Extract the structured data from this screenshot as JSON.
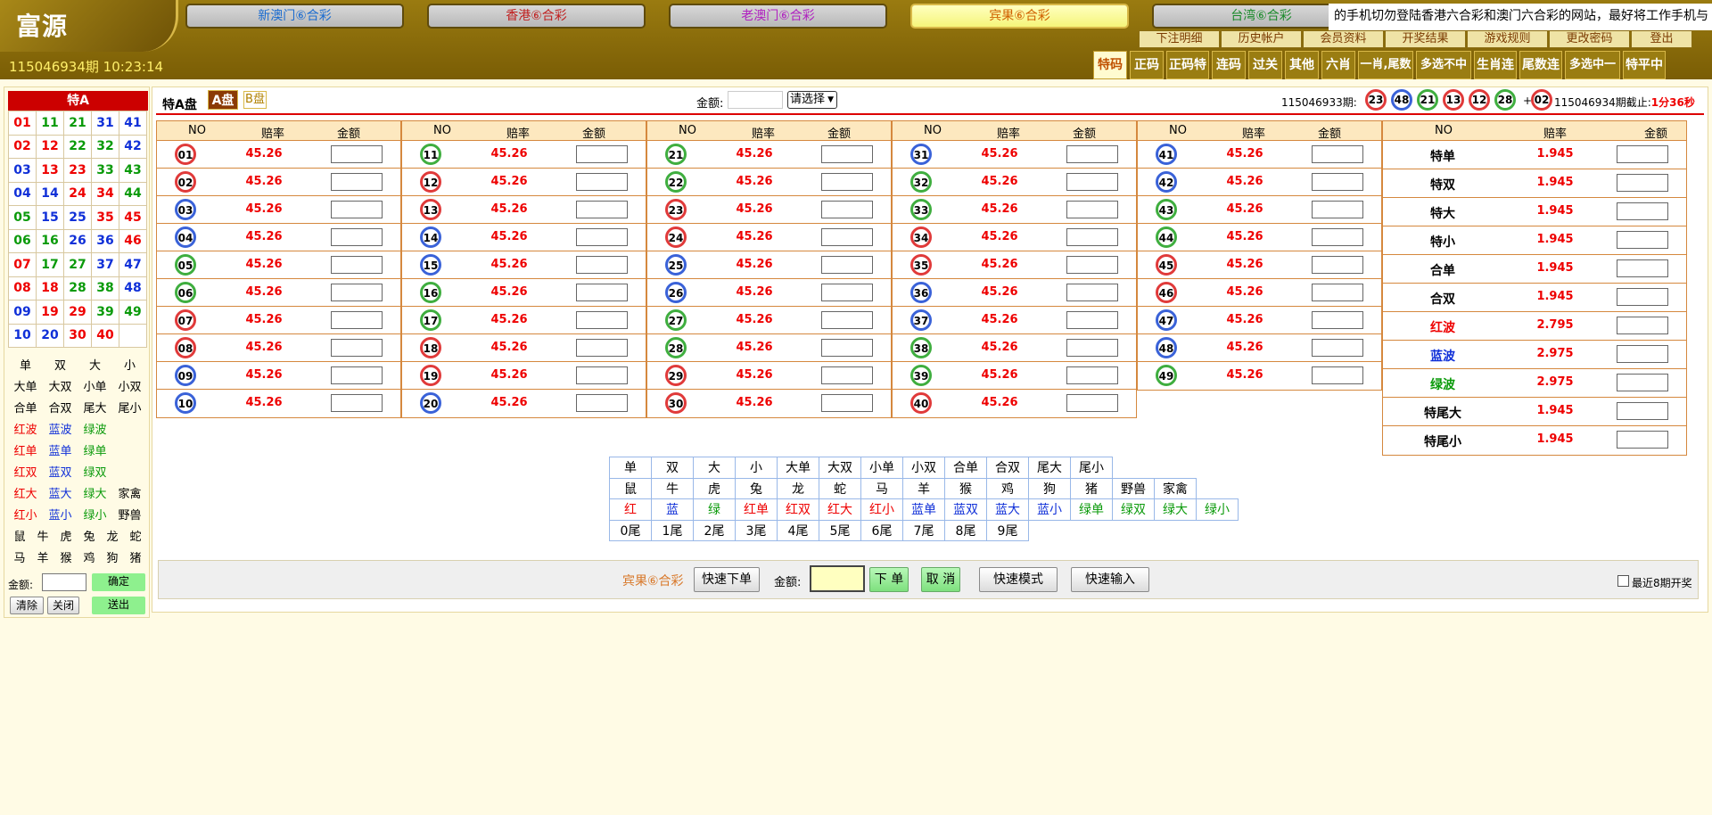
{
  "brand": {
    "logo": "富源",
    "issue_time": "115046934期 10:23:14"
  },
  "lotto_tabs": [
    {
      "label": "新澳门⑥合彩",
      "color": "#1a6bd0"
    },
    {
      "label": "香港⑥合彩",
      "color": "#c02020"
    },
    {
      "label": "老澳门⑥合彩",
      "color": "#b020c0"
    },
    {
      "label": "宾果⑥合彩",
      "color": "#d06000"
    },
    {
      "label": "台湾⑥合彩",
      "color": "#1a8a2a"
    }
  ],
  "ticker": "的手机切勿登陆香港六合彩和澳门六合彩的网站，最好将工作手机与",
  "top_menu": [
    "下注明细",
    "历史帐户",
    "会员资料",
    "开奖结果",
    "游戏规则",
    "更改密码",
    "登出"
  ],
  "nav_tabs": [
    "特码",
    "正码",
    "正码特",
    "连码",
    "过关",
    "其他",
    "六肖",
    "一肖,尾数",
    "多选不中",
    "生肖连",
    "尾数连",
    "多选中一",
    "特平中"
  ],
  "sidebar": {
    "title": "特A",
    "grid": [
      [
        "01",
        "11",
        "21",
        "31",
        "41"
      ],
      [
        "02",
        "12",
        "22",
        "32",
        "42"
      ],
      [
        "03",
        "13",
        "23",
        "33",
        "43"
      ],
      [
        "04",
        "14",
        "24",
        "34",
        "44"
      ],
      [
        "05",
        "15",
        "25",
        "35",
        "45"
      ],
      [
        "06",
        "16",
        "26",
        "36",
        "46"
      ],
      [
        "07",
        "17",
        "27",
        "37",
        "47"
      ],
      [
        "08",
        "18",
        "28",
        "38",
        "48"
      ],
      [
        "09",
        "19",
        "29",
        "39",
        "49"
      ],
      [
        "10",
        "20",
        "30",
        "40",
        ""
      ]
    ],
    "grid_colors": [
      [
        "r",
        "g",
        "g",
        "b",
        "b"
      ],
      [
        "r",
        "r",
        "g",
        "g",
        "b"
      ],
      [
        "b",
        "r",
        "r",
        "g",
        "g"
      ],
      [
        "b",
        "b",
        "r",
        "r",
        "g"
      ],
      [
        "g",
        "b",
        "b",
        "r",
        "r"
      ],
      [
        "g",
        "g",
        "b",
        "b",
        "r"
      ],
      [
        "r",
        "g",
        "g",
        "b",
        "b"
      ],
      [
        "r",
        "r",
        "g",
        "g",
        "b"
      ],
      [
        "b",
        "r",
        "r",
        "g",
        "g"
      ],
      [
        "b",
        "b",
        "r",
        "r",
        "k"
      ]
    ],
    "options": [
      [
        {
          "t": "单",
          "c": "k"
        },
        {
          "t": "双",
          "c": "k"
        },
        {
          "t": "大",
          "c": "k"
        },
        {
          "t": "小",
          "c": "k"
        }
      ],
      [
        {
          "t": "大单",
          "c": "k"
        },
        {
          "t": "大双",
          "c": "k"
        },
        {
          "t": "小单",
          "c": "k"
        },
        {
          "t": "小双",
          "c": "k"
        }
      ],
      [
        {
          "t": "合单",
          "c": "k"
        },
        {
          "t": "合双",
          "c": "k"
        },
        {
          "t": "尾大",
          "c": "k"
        },
        {
          "t": "尾小",
          "c": "k"
        }
      ],
      [
        {
          "t": "红波",
          "c": "r"
        },
        {
          "t": "蓝波",
          "c": "b"
        },
        {
          "t": "绿波",
          "c": "g"
        }
      ],
      [
        {
          "t": "红单",
          "c": "r"
        },
        {
          "t": "蓝单",
          "c": "b"
        },
        {
          "t": "绿单",
          "c": "g"
        }
      ],
      [
        {
          "t": "红双",
          "c": "r"
        },
        {
          "t": "蓝双",
          "c": "b"
        },
        {
          "t": "绿双",
          "c": "g"
        }
      ],
      [
        {
          "t": "红大",
          "c": "r"
        },
        {
          "t": "蓝大",
          "c": "b"
        },
        {
          "t": "绿大",
          "c": "g"
        },
        {
          "t": "家禽",
          "c": "k"
        }
      ],
      [
        {
          "t": "红小",
          "c": "r"
        },
        {
          "t": "蓝小",
          "c": "b"
        },
        {
          "t": "绿小",
          "c": "g"
        },
        {
          "t": "野兽",
          "c": "k"
        }
      ],
      [
        {
          "t": "鼠",
          "c": "k"
        },
        {
          "t": "牛",
          "c": "k"
        },
        {
          "t": "虎",
          "c": "k"
        },
        {
          "t": "兔",
          "c": "k"
        },
        {
          "t": "龙",
          "c": "k"
        },
        {
          "t": "蛇",
          "c": "k"
        }
      ],
      [
        {
          "t": "马",
          "c": "k"
        },
        {
          "t": "羊",
          "c": "k"
        },
        {
          "t": "猴",
          "c": "k"
        },
        {
          "t": "鸡",
          "c": "k"
        },
        {
          "t": "狗",
          "c": "k"
        },
        {
          "t": "猪",
          "c": "k"
        }
      ]
    ],
    "amount_label": "金额:",
    "confirm": "确定",
    "clear": "清除",
    "close": "关闭",
    "submit": "送出"
  },
  "main": {
    "plate_title": "特A盘",
    "plate_a": "A盘",
    "plate_b": "B盘",
    "amount_label": "金额:",
    "select_placeholder": "请选择",
    "last_issue": "115046933期:",
    "last_balls": [
      "23",
      "48",
      "21",
      "13",
      "12",
      "28"
    ],
    "last_ball_colors": [
      "red",
      "blue",
      "green",
      "red",
      "red",
      "green"
    ],
    "plus": "+",
    "special_ball": "02",
    "special_color": "red",
    "next_issue": "115046934期截止:",
    "countdown": "1分36秒",
    "col_headers": [
      "NO",
      "赔率",
      "金额"
    ],
    "odds": "45.26",
    "ball_colors": [
      "red",
      "red",
      "blue",
      "blue",
      "green",
      "green",
      "red",
      "red",
      "blue",
      "blue",
      "green",
      "red",
      "red",
      "blue",
      "blue",
      "green",
      "green",
      "red",
      "red",
      "blue",
      "green",
      "green",
      "red",
      "red",
      "blue",
      "blue",
      "green",
      "green",
      "red",
      "red",
      "blue",
      "green",
      "green",
      "red",
      "red",
      "blue",
      "blue",
      "green",
      "green",
      "red",
      "blue",
      "blue",
      "green",
      "green",
      "red",
      "red",
      "blue",
      "blue",
      "green"
    ],
    "side_bets": [
      {
        "label": "特单",
        "odds": "1.945",
        "c": "k"
      },
      {
        "label": "特双",
        "odds": "1.945",
        "c": "k"
      },
      {
        "label": "特大",
        "odds": "1.945",
        "c": "k"
      },
      {
        "label": "特小",
        "odds": "1.945",
        "c": "k"
      },
      {
        "label": "合单",
        "odds": "1.945",
        "c": "k"
      },
      {
        "label": "合双",
        "odds": "1.945",
        "c": "k"
      },
      {
        "label": "红波",
        "odds": "2.795",
        "c": "r"
      },
      {
        "label": "蓝波",
        "odds": "2.975",
        "c": "b"
      },
      {
        "label": "绿波",
        "odds": "2.975",
        "c": "g"
      },
      {
        "label": "特尾大",
        "odds": "1.945",
        "c": "k"
      },
      {
        "label": "特尾小",
        "odds": "1.945",
        "c": "k"
      }
    ],
    "quick_rows": [
      [
        {
          "t": "单",
          "c": "k"
        },
        {
          "t": "双",
          "c": "k"
        },
        {
          "t": "大",
          "c": "k"
        },
        {
          "t": "小",
          "c": "k"
        },
        {
          "t": "大单",
          "c": "k"
        },
        {
          "t": "大双",
          "c": "k"
        },
        {
          "t": "小单",
          "c": "k"
        },
        {
          "t": "小双",
          "c": "k"
        },
        {
          "t": "合单",
          "c": "k"
        },
        {
          "t": "合双",
          "c": "k"
        },
        {
          "t": "尾大",
          "c": "k"
        },
        {
          "t": "尾小",
          "c": "k"
        }
      ],
      [
        {
          "t": "鼠",
          "c": "k"
        },
        {
          "t": "牛",
          "c": "k"
        },
        {
          "t": "虎",
          "c": "k"
        },
        {
          "t": "兔",
          "c": "k"
        },
        {
          "t": "龙",
          "c": "k"
        },
        {
          "t": "蛇",
          "c": "k"
        },
        {
          "t": "马",
          "c": "k"
        },
        {
          "t": "羊",
          "c": "k"
        },
        {
          "t": "猴",
          "c": "k"
        },
        {
          "t": "鸡",
          "c": "k"
        },
        {
          "t": "狗",
          "c": "k"
        },
        {
          "t": "猪",
          "c": "k"
        },
        {
          "t": "野兽",
          "c": "k"
        },
        {
          "t": "家禽",
          "c": "k"
        }
      ],
      [
        {
          "t": "红",
          "c": "r"
        },
        {
          "t": "蓝",
          "c": "b"
        },
        {
          "t": "绿",
          "c": "g"
        },
        {
          "t": "红单",
          "c": "r"
        },
        {
          "t": "红双",
          "c": "r"
        },
        {
          "t": "红大",
          "c": "r"
        },
        {
          "t": "红小",
          "c": "r"
        },
        {
          "t": "蓝单",
          "c": "b"
        },
        {
          "t": "蓝双",
          "c": "b"
        },
        {
          "t": "蓝大",
          "c": "b"
        },
        {
          "t": "蓝小",
          "c": "b"
        },
        {
          "t": "绿单",
          "c": "g"
        },
        {
          "t": "绿双",
          "c": "g"
        },
        {
          "t": "绿大",
          "c": "g"
        },
        {
          "t": "绿小",
          "c": "g"
        }
      ],
      [
        {
          "t": "0尾",
          "c": "k"
        },
        {
          "t": "1尾",
          "c": "k"
        },
        {
          "t": "2尾",
          "c": "k"
        },
        {
          "t": "3尾",
          "c": "k"
        },
        {
          "t": "4尾",
          "c": "k"
        },
        {
          "t": "5尾",
          "c": "k"
        },
        {
          "t": "6尾",
          "c": "k"
        },
        {
          "t": "7尾",
          "c": "k"
        },
        {
          "t": "8尾",
          "c": "k"
        },
        {
          "t": "9尾",
          "c": "k"
        }
      ]
    ],
    "bottom": {
      "game_name": "宾果⑥合彩",
      "quick_order": "快速下单",
      "amount_label": "金额:",
      "place": "下 单",
      "cancel": "取 消",
      "quick_mode": "快速模式",
      "quick_input": "快速输入",
      "recent_draws": "最近8期开奖"
    }
  }
}
